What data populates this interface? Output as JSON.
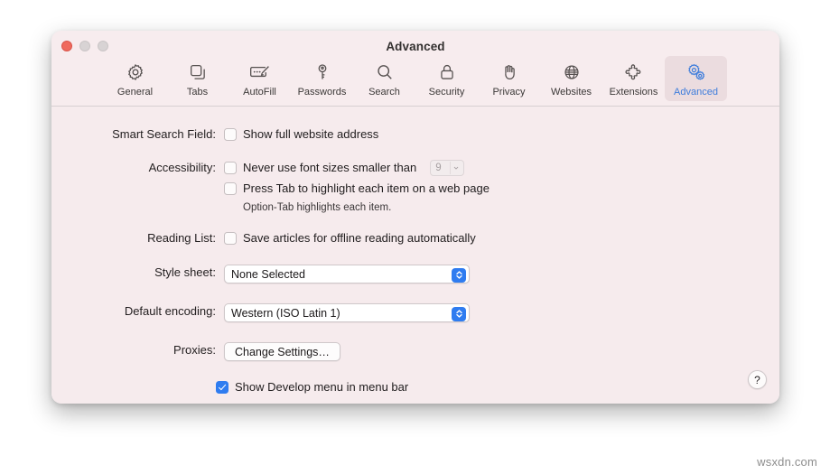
{
  "window": {
    "title": "Advanced",
    "traffic_lights": [
      "close",
      "minimize",
      "zoom"
    ]
  },
  "toolbar": {
    "items": [
      {
        "label": "General",
        "icon": "gear-icon",
        "selected": false
      },
      {
        "label": "Tabs",
        "icon": "tabs-icon",
        "selected": false
      },
      {
        "label": "AutoFill",
        "icon": "autofill-icon",
        "selected": false
      },
      {
        "label": "Passwords",
        "icon": "key-icon",
        "selected": false
      },
      {
        "label": "Search",
        "icon": "search-icon",
        "selected": false
      },
      {
        "label": "Security",
        "icon": "lock-icon",
        "selected": false
      },
      {
        "label": "Privacy",
        "icon": "hand-icon",
        "selected": false
      },
      {
        "label": "Websites",
        "icon": "globe-icon",
        "selected": false
      },
      {
        "label": "Extensions",
        "icon": "puzzle-icon",
        "selected": false
      },
      {
        "label": "Advanced",
        "icon": "gears-icon",
        "selected": true
      }
    ]
  },
  "settings": {
    "smart_search_field": {
      "label": "Smart Search Field:",
      "show_full_address": {
        "text": "Show full website address",
        "checked": false
      }
    },
    "accessibility": {
      "label": "Accessibility:",
      "min_font": {
        "text": "Never use font sizes smaller than",
        "checked": false,
        "size_value": "9",
        "size_disabled": true
      },
      "press_tab": {
        "text": "Press Tab to highlight each item on a web page",
        "checked": false
      },
      "hint": "Option-Tab highlights each item."
    },
    "reading_list": {
      "label": "Reading List:",
      "save_offline": {
        "text": "Save articles for offline reading automatically",
        "checked": false
      }
    },
    "style_sheet": {
      "label": "Style sheet:",
      "value": "None Selected"
    },
    "default_encoding": {
      "label": "Default encoding:",
      "value": "Western (ISO Latin 1)"
    },
    "proxies": {
      "label": "Proxies:",
      "button": "Change Settings…"
    },
    "develop_menu": {
      "text": "Show Develop menu in menu bar",
      "checked": true
    }
  },
  "help_button": {
    "glyph": "?"
  },
  "watermark": "wsxdn.com",
  "colors": {
    "window_bg": "#f6ebed",
    "accent_blue": "#2f7cf0",
    "selected_tab_bg": "#ebdcdf",
    "text": "#201d1e"
  }
}
